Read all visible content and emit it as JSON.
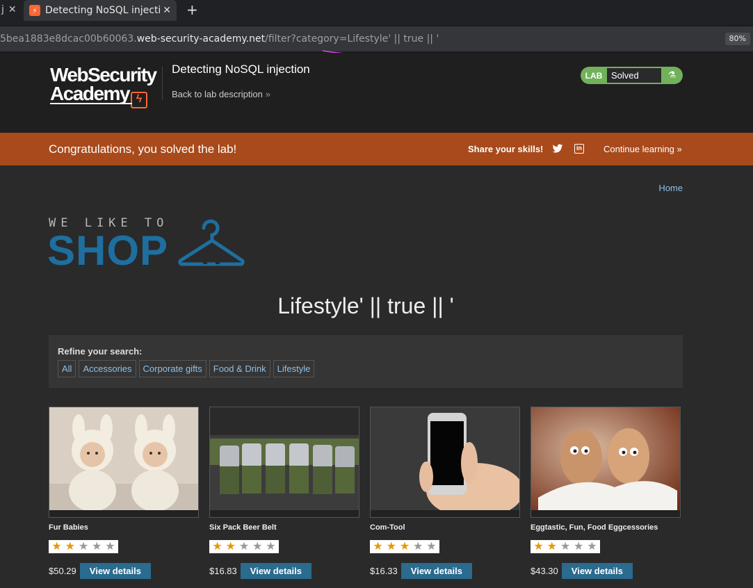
{
  "browser": {
    "prev_tab_fragment": "j",
    "active_tab_title": "Detecting NoSQL injectio",
    "url_prefix": "5bea1883e8dcac00b60063.",
    "url_domain": "web-security-academy.net",
    "url_path": "/filter?category=Lifestyle' || true || '",
    "zoom": "80%"
  },
  "header": {
    "logo_line1": "WebSecurity",
    "logo_line2": "Academy",
    "lab_title": "Detecting NoSQL injection",
    "back_link": "Back to lab description",
    "badge_lab": "LAB",
    "badge_status": "Solved"
  },
  "banner": {
    "message": "Congratulations, you solved the lab!",
    "share_label": "Share your skills!",
    "continue_label": "Continue learning"
  },
  "shop": {
    "home_link": "Home",
    "logo_small": "WE LIKE TO",
    "logo_big": "SHOP",
    "category_title": "Lifestyle' || true || '",
    "filter_label": "Refine your search:",
    "filters": [
      "All",
      "Accessories",
      "Corporate gifts",
      "Food & Drink",
      "Lifestyle"
    ],
    "view_label": "View details",
    "products": [
      {
        "name": "Fur Babies",
        "rating": 2,
        "price": "$50.29"
      },
      {
        "name": "Six Pack Beer Belt",
        "rating": 2,
        "price": "$16.83"
      },
      {
        "name": "Com-Tool",
        "rating": 3,
        "price": "$16.33"
      },
      {
        "name": "Eggtastic, Fun, Food Eggcessories",
        "rating": 2,
        "price": "$43.30"
      }
    ]
  },
  "colors": {
    "banner": "#a84a1b",
    "shop_blue": "#1e6f9f",
    "badge_green": "#70b15a",
    "button": "#2a6b8e"
  }
}
